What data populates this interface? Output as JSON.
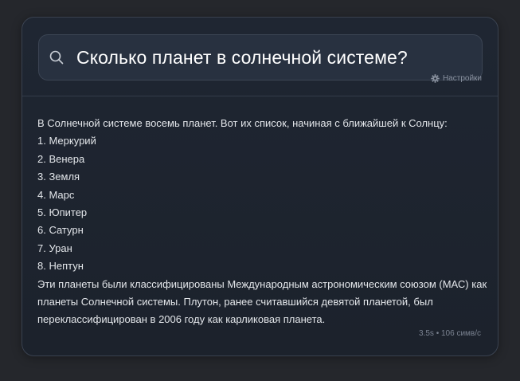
{
  "search": {
    "query": "Сколько планет в солнечной системе?"
  },
  "settings": {
    "label": "Настройки"
  },
  "answer": {
    "intro": "В Солнечной системе восемь планет. Вот их список, начиная с ближайшей к Солнцу:",
    "planets": [
      "1. Меркурий",
      "2. Венера",
      "3. Земля",
      "4. Марс",
      "5. Юпитер",
      "6. Сатурн",
      "7. Уран",
      "8. Нептун"
    ],
    "conclusion": "Эти планеты были классифицированы Международным астрономическим союзом (МАС) как планеты Солнечной системы. Плутон, ранее считавшийся девятой планетой, был переклассифицирован в 2006 году как карликовая планета."
  },
  "stats": {
    "text": "3.5s • 106 симв/с"
  },
  "colors": {
    "background": "#25272c",
    "card": "#1f2632",
    "search_box": "#283140",
    "text_primary": "#ffffff",
    "text_muted": "#8a92a0"
  },
  "icons": {
    "search": "search-icon",
    "settings": "gear-icon"
  }
}
